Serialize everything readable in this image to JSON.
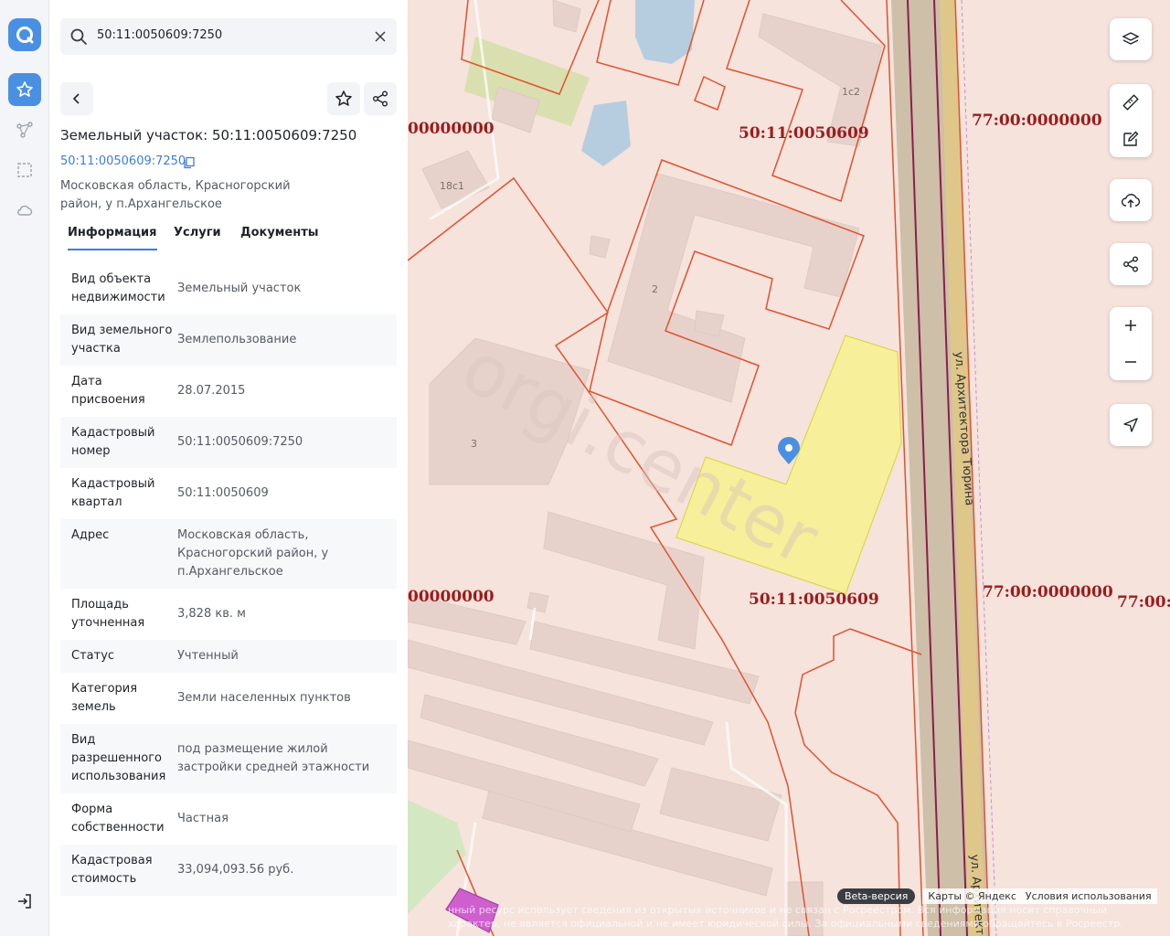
{
  "search": {
    "value": "50:11:0050609:7250"
  },
  "panel": {
    "title": "Земельный участок: 50:11:0050609:7250",
    "cadastral_link": "50:11:0050609:7250",
    "address": "Московская область, Красногорский район, у п.Архангельское",
    "tabs": [
      "Информация",
      "Услуги",
      "Документы"
    ],
    "rows": [
      {
        "k": "Вид объекта недвижимости",
        "v": "Земельный участок"
      },
      {
        "k": "Вид земельного участка",
        "v": "Землепользование"
      },
      {
        "k": "Дата присвоения",
        "v": "28.07.2015"
      },
      {
        "k": "Кадастровый номер",
        "v": "50:11:0050609:7250"
      },
      {
        "k": "Кадастровый квартал",
        "v": "50:11:0050609"
      },
      {
        "k": "Адрес",
        "v": "Московская область, Красногорский район, у п.Архангельское"
      },
      {
        "k": "Площадь уточненная",
        "v": "3,828 кв. м"
      },
      {
        "k": "Статус",
        "v": "Учтенный"
      },
      {
        "k": "Категория земель",
        "v": "Земли населенных пунктов"
      },
      {
        "k": "Вид разрешенного использования",
        "v": "под размещение жилой застройки средней этажности"
      },
      {
        "k": "Форма собственности",
        "v": "Частная"
      },
      {
        "k": "Кадастровая стоимость",
        "v": "33,094,093.56 руб."
      }
    ]
  },
  "map": {
    "cadastral_labels": [
      "50:11:0050609",
      "50:11:0050609",
      "77:00:0000000",
      "77:00:0000000",
      "77:00:0",
      "00000000",
      "00000000"
    ],
    "building_labels": [
      "1с2",
      "18с1",
      "2",
      "3"
    ],
    "street_labels": [
      "ул. Архитектора Тюрина",
      "ул. Архитекто"
    ],
    "watermark": "orgi.center",
    "beta": "Beta-версия",
    "attribution": "Карты © Яндекс",
    "terms": "Условия использования",
    "disclaimer": "нный ресурс использует сведения из открытых источников и не связан с Росреестром. Вся информация носит справочный характер, не является официальной и не имеет юридической силы. За официальными сведениями обращайтесь в Росреестр.",
    "colors": {
      "parcel_fill": "#f7ef99",
      "boundary": "#e0522f",
      "road": "#cdbfa8",
      "accent": "#4a90e2"
    }
  }
}
